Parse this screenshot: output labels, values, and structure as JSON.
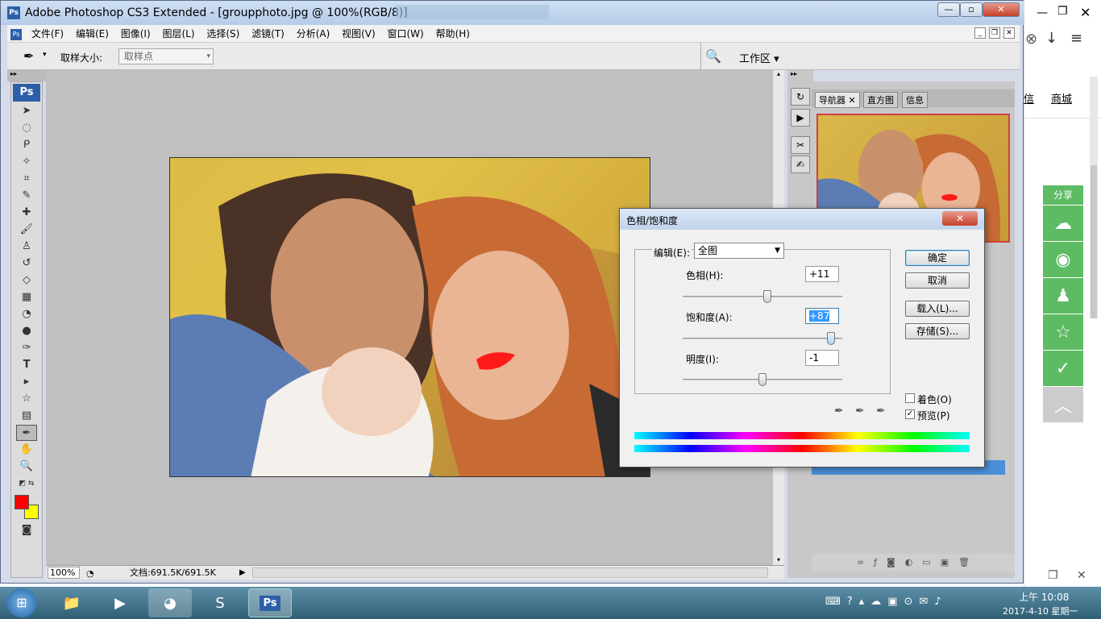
{
  "window": {
    "title": "Adobe Photoshop CS3 Extended - [groupphoto.jpg @ 100%(RGB/8)]",
    "app_icon": "Ps"
  },
  "menu": [
    "文件(F)",
    "编辑(E)",
    "图像(I)",
    "图层(L)",
    "选择(S)",
    "滤镜(T)",
    "分析(A)",
    "视图(V)",
    "窗口(W)",
    "帮助(H)"
  ],
  "options": {
    "sample_size_label": "取样大小:",
    "sample_size_value": "取样点",
    "workspace_label": "工作区"
  },
  "toolbox": {
    "logo": "Ps",
    "foreground_color": "#ff0000",
    "background_color": "#ffff00"
  },
  "status": {
    "zoom": "100%",
    "doc_info": "文档:691.5K/691.5K"
  },
  "panels": {
    "tabs": [
      "导航器",
      "直方图",
      "信息"
    ]
  },
  "dialog": {
    "title": "色相/饱和度",
    "edit_label": "编辑(E):",
    "edit_value": "全图",
    "hue_label": "色相(H):",
    "hue_value": "+11",
    "hue_level": 0.53,
    "saturation_label": "饱和度(A):",
    "saturation_value": "+87",
    "saturation_level": 0.93,
    "lightness_label": "明度(I):",
    "lightness_value": "-1",
    "lightness_level": 0.5,
    "ok": "确定",
    "cancel": "取消",
    "load": "载入(L)...",
    "save": "存储(S)...",
    "colorize_label": "着色(O)",
    "colorize_checked": false,
    "preview_label": "预览(P)",
    "preview_checked": true
  },
  "browser": {
    "links": [
      "信",
      "商城"
    ],
    "share_title": "分享"
  },
  "taskbar": {
    "time": "上午 10:08",
    "date": "2017-4-10 星期一"
  }
}
